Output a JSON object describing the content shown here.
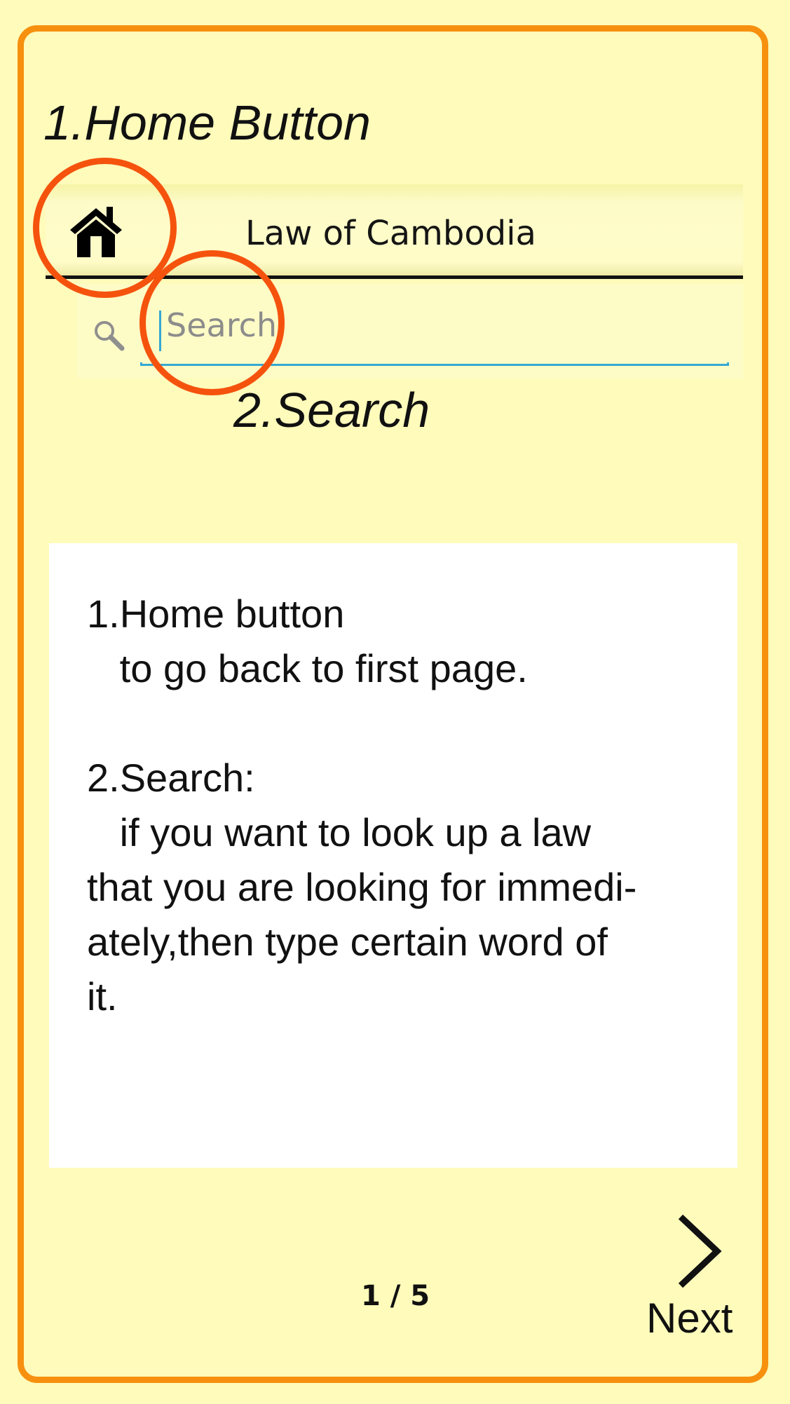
{
  "callouts": {
    "home": "1.Home Button",
    "search": "2.Search"
  },
  "app_bar": {
    "title": "Law of Cambodia",
    "home_icon": "home-icon"
  },
  "search": {
    "placeholder": "Search",
    "value": "",
    "icon": "search-icon"
  },
  "help_panel": {
    "lines": [
      "1.Home button",
      "   to go back to first page.",
      "",
      "2.Search:",
      "   if you want to look up a law",
      "that you are looking for immedi-",
      "ately,then type certain word of",
      "it."
    ]
  },
  "pager": {
    "text": "1 / 5"
  },
  "next": {
    "label": "Next",
    "icon": "chevron-right-icon"
  },
  "colors": {
    "background": "#fffbbb",
    "frame_border": "#f7900e",
    "highlight_circle": "#f5530d",
    "search_accent": "#33a8d2"
  }
}
